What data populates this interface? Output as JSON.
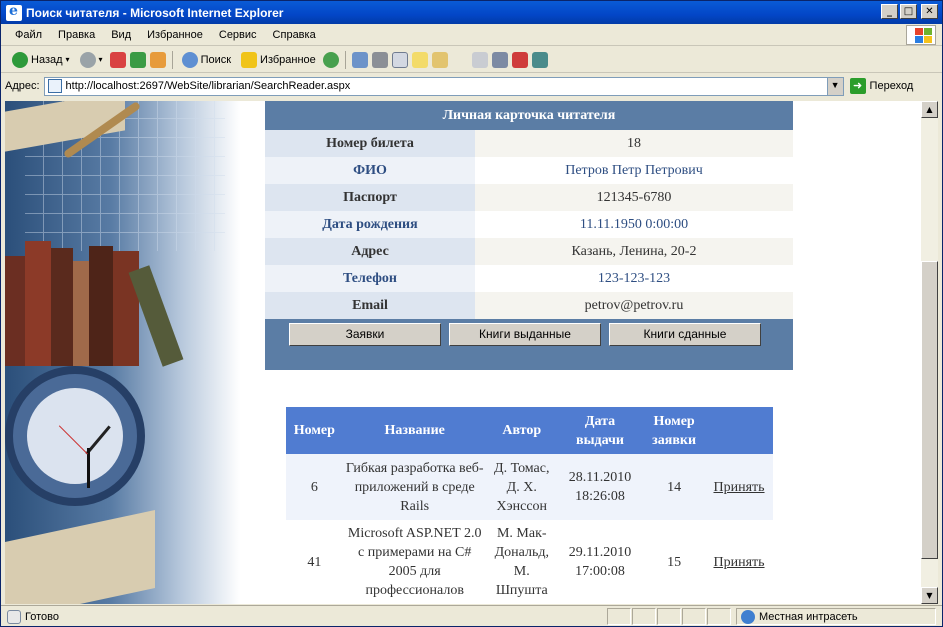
{
  "window": {
    "title": "Поиск читателя - Microsoft Internet Explorer"
  },
  "menu": [
    "Файл",
    "Правка",
    "Вид",
    "Избранное",
    "Сервис",
    "Справка"
  ],
  "toolbar": {
    "back": "Назад",
    "search": "Поиск",
    "favorites": "Избранное"
  },
  "address": {
    "label": "Адрес:",
    "url": "http://localhost:2697/WebSite/librarian/SearchReader.aspx",
    "go": "Переход"
  },
  "card": {
    "title": "Личная карточка читателя",
    "rows": [
      {
        "label": "Номер билета",
        "value": "18"
      },
      {
        "label": "ФИО",
        "value": "Петров Петр Петрович"
      },
      {
        "label": "Паспорт",
        "value": "121345-6780"
      },
      {
        "label": "Дата рождения",
        "value": "11.11.1950 0:00:00"
      },
      {
        "label": "Адрес",
        "value": "Казань, Ленина, 20-2"
      },
      {
        "label": "Телефон",
        "value": "123-123-123"
      },
      {
        "label": "Email",
        "value": "petrov@petrov.ru"
      }
    ],
    "buttons": [
      "Заявки",
      "Книги выданные",
      "Книги сданные"
    ]
  },
  "books": {
    "headers": [
      "Номер",
      "Название",
      "Автор",
      "Дата выдачи",
      "Номер заявки",
      ""
    ],
    "rows": [
      {
        "num": "6",
        "title": "Гибкая разработка веб-приложений в среде Rails",
        "author": "Д. Томас, Д. Х. Хэнссон",
        "date": "28.11.2010 18:26:08",
        "request": "14",
        "action": "Принять"
      },
      {
        "num": "41",
        "title": "Microsoft ASP.NET 2.0 с примерами на C# 2005 для профессионалов",
        "author": "М. Мак-Дональд, М. Шпушта",
        "date": "29.11.2010 17:00:08",
        "request": "15",
        "action": "Принять"
      }
    ]
  },
  "status": {
    "text": "Готово",
    "zone": "Местная интрасеть"
  }
}
